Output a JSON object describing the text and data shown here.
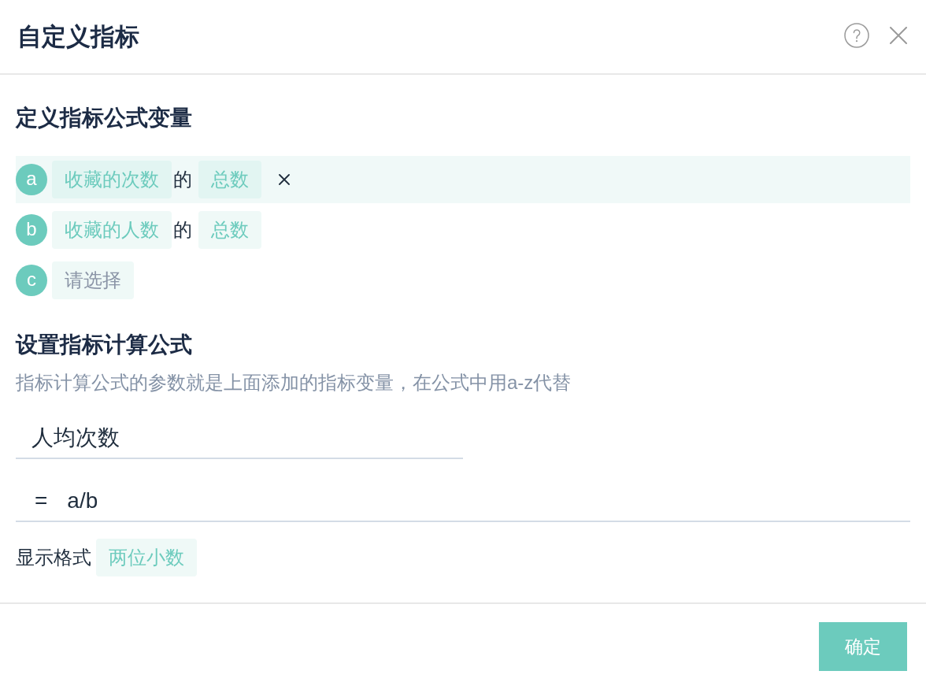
{
  "dialog": {
    "title": "自定义指标"
  },
  "variables_section": {
    "title": "定义指标公式变量",
    "variables": [
      {
        "letter": "a",
        "selected": true,
        "metric": "收藏的次数",
        "connector": "的",
        "aggregate": "总数"
      },
      {
        "letter": "b",
        "selected": false,
        "metric": "收藏的人数",
        "connector": "的",
        "aggregate": "总数"
      },
      {
        "letter": "c",
        "selected": false,
        "placeholder": "请选择"
      }
    ]
  },
  "formula_section": {
    "title": "设置指标计算公式",
    "description": "指标计算公式的参数就是上面添加的指标变量，在公式中用a-z代替",
    "name_field": {
      "value": "人均次数"
    },
    "formula_field": {
      "operator": "=",
      "value": "a/b"
    },
    "display_format": {
      "label": "显示格式",
      "value": "两位小数"
    }
  },
  "footer": {
    "buttons": [
      "确定"
    ]
  }
}
